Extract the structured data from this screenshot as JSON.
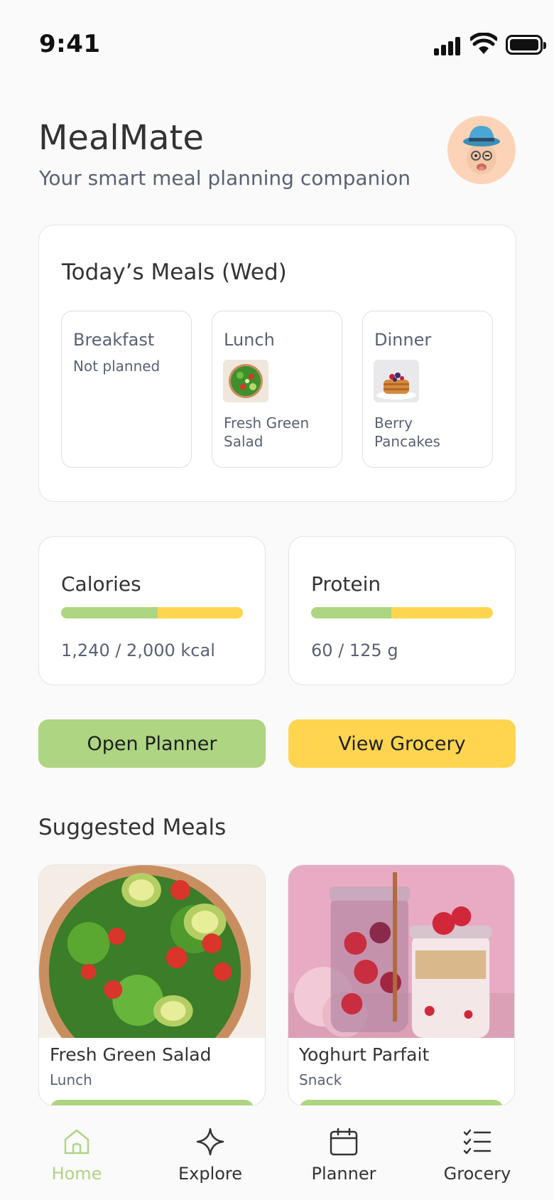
{
  "status_bar": {
    "time": "9:41"
  },
  "header": {
    "title": "MealMate",
    "subtitle": "Your smart meal planning companion"
  },
  "today": {
    "title": "Today’s Meals (Wed)",
    "meals": [
      {
        "label": "Breakfast",
        "status": "Not planned",
        "dish": ""
      },
      {
        "label": "Lunch",
        "status": "",
        "dish": "Fresh Green Salad"
      },
      {
        "label": "Dinner",
        "status": "",
        "dish": "Berry Pancakes"
      }
    ]
  },
  "stats": [
    {
      "title": "Calories",
      "text": "1,240 / 2,000 kcal",
      "progress": 0.53
    },
    {
      "title": "Protein",
      "text": "60 / 125 g",
      "progress": 0.44
    }
  ],
  "actions": {
    "planner": "Open Planner",
    "grocery": "View Grocery"
  },
  "suggested": {
    "title": "Suggested Meals",
    "items": [
      {
        "name": "Fresh Green Salad",
        "type": "Lunch"
      },
      {
        "name": "Yoghurt Parfait",
        "type": "Snack"
      }
    ]
  },
  "tabs": [
    {
      "label": "Home",
      "icon": "home-icon",
      "active": true
    },
    {
      "label": "Explore",
      "icon": "sparkle-icon",
      "active": false
    },
    {
      "label": "Planner",
      "icon": "calendar-icon",
      "active": false
    },
    {
      "label": "Grocery",
      "icon": "checklist-icon",
      "active": false
    }
  ],
  "colors": {
    "accent_green": "#aed581",
    "accent_yellow": "#ffd54f",
    "text_muted": "#5a6175"
  }
}
